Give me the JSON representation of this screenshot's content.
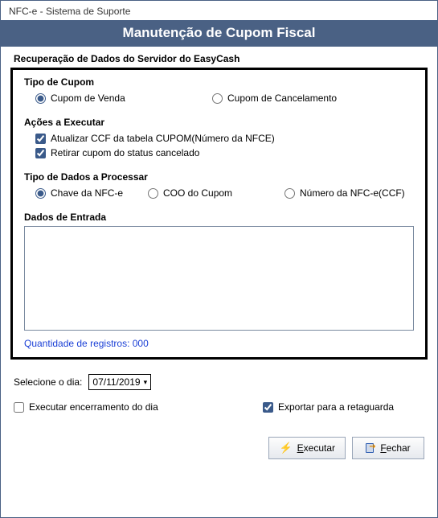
{
  "window": {
    "title": "NFC-e - Sistema de Suporte"
  },
  "header": {
    "title": "Manutenção de Cupom Fiscal"
  },
  "section": {
    "title": "Recuperação de Dados do Servidor do EasyCash"
  },
  "tipoCupom": {
    "label": "Tipo de Cupom",
    "venda": "Cupom de Venda",
    "cancelamento": "Cupom de Cancelamento"
  },
  "acoes": {
    "label": "Ações a Executar",
    "ccf": "Atualizar CCF da tabela CUPOM(Número da NFCE)",
    "retirar": "Retirar cupom do status cancelado"
  },
  "tipoDados": {
    "label": "Tipo de Dados a Processar",
    "chave": "Chave da NFC-e",
    "coo": "COO do Cupom",
    "numero": "Número da NFC-e(CCF)"
  },
  "entrada": {
    "label": "Dados de Entrada",
    "value": "",
    "registros": "Quantidade de registros: 000"
  },
  "dateRow": {
    "label": "Selecione o dia:",
    "value": "07/11/2019"
  },
  "bottomChecks": {
    "encerramento": "Executar encerramento do dia",
    "exportar": "Exportar para a retaguarda"
  },
  "buttons": {
    "executar": "xecutar",
    "executar_hot": "E",
    "fechar": "echar",
    "fechar_hot": "F"
  }
}
